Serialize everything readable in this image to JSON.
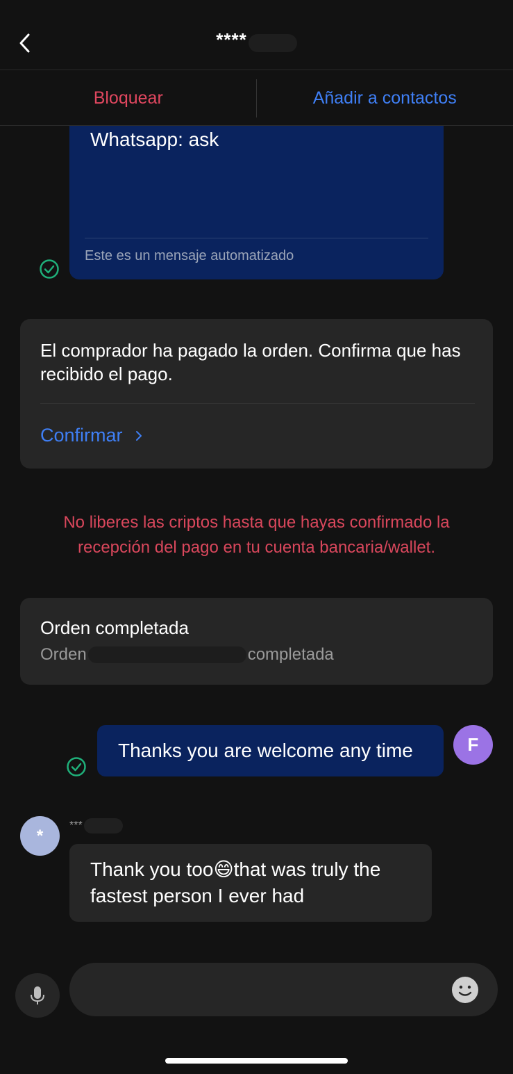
{
  "header": {
    "title": "****",
    "back_icon": "chevron-left-icon"
  },
  "actions": {
    "block_label": "Bloquear",
    "add_label": "Añadir a contactos"
  },
  "auto_message": {
    "text": "Whatsapp: ask",
    "note": "Este es un mensaje automatizado"
  },
  "payment_card": {
    "text": "El comprador ha pagado la orden. Confirma que has recibido el pago.",
    "confirm_label": "Confirmar"
  },
  "warning": "No liberes las criptos hasta que hayas confirmado la recepción del pago en tu cuenta bancaria/wallet.",
  "order_card": {
    "title": "Orden completada",
    "sub_prefix": "Orden",
    "sub_suffix": "completada"
  },
  "outgoing_message": {
    "text": "Thanks you are welcome any time",
    "avatar_letter": "F"
  },
  "incoming_message": {
    "avatar_letter": "*",
    "sender": "***",
    "text": "Thank you too😄that was truly the fastest person I ever had"
  },
  "input": {
    "value": "",
    "placeholder": ""
  },
  "colors": {
    "background": "#121212",
    "danger": "#e0475f",
    "accent": "#3f7ff5",
    "bubble_blue": "#0a235e",
    "card": "#262626",
    "success": "#1fb07a",
    "avatar_f": "#9b73e5",
    "avatar_star": "#a9b6dd"
  }
}
